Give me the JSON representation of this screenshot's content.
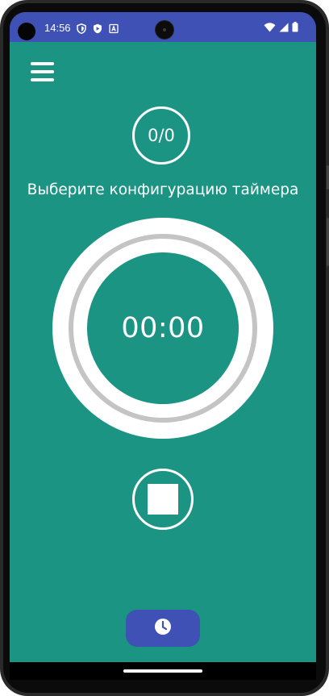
{
  "status_bar": {
    "time": "14:56",
    "icons_left": [
      "shield-icon",
      "play-shield-icon",
      "a-badge-icon"
    ],
    "icons_right": [
      "wifi-icon",
      "signal-icon",
      "battery-icon"
    ],
    "background": "#3f51b5"
  },
  "app": {
    "background": "#1b9484",
    "menu_icon": "hamburger-menu-icon",
    "counter": "0/0",
    "prompt": "Выберите конфигурацию таймера",
    "timer_display": "00:00",
    "stop_icon": "stop-icon",
    "fab_icon": "clock-icon",
    "fab_color": "#3f51b5"
  }
}
